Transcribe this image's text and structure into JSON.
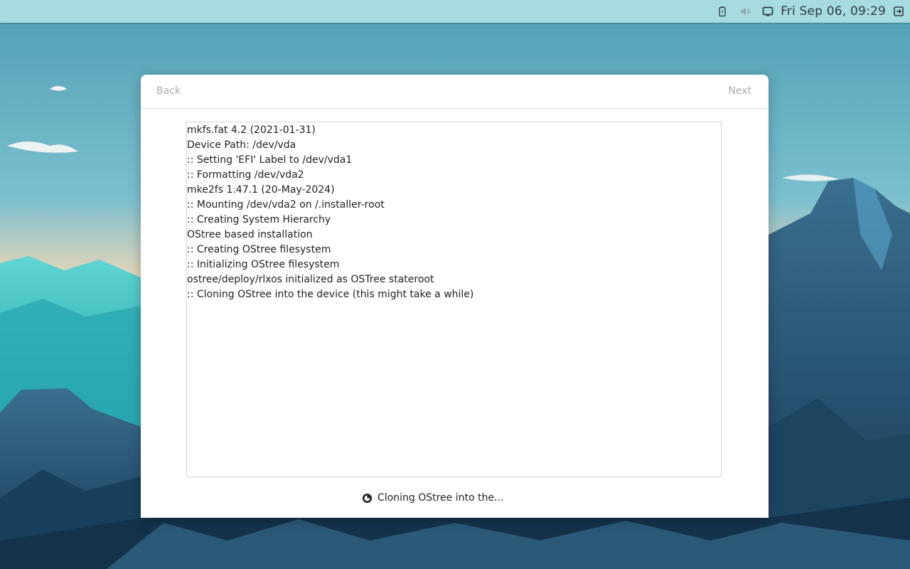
{
  "topbar": {
    "clock": "Fri Sep 06, 09:29",
    "icons": [
      "battery-icon",
      "volume-icon",
      "display-icon",
      "logout-icon"
    ]
  },
  "installer": {
    "back_label": "Back",
    "next_label": "Next",
    "log_lines": [
      "mkfs.fat 4.2 (2021-01-31)",
      "Device Path: /dev/vda",
      ":: Setting 'EFI' Label to /dev/vda1",
      ":: Formatting /dev/vda2",
      "mke2fs 1.47.1 (20-May-2024)",
      ":: Mounting /dev/vda2 on /.installer-root",
      ":: Creating System Hierarchy",
      "OStree based installation",
      ":: Creating OStree filesystem",
      ":: Initializing OStree filesystem",
      "ostree/deploy/rlxos initialized as OSTree stateroot",
      ":: Cloning OStree into the device (this might take a while)"
    ],
    "status_text": "Cloning OStree into the..."
  },
  "colors": {
    "topbar": "#a6dbe0",
    "sky": "#6cb3c5",
    "mountain_dark": "#1f4d6b",
    "mountain_teal": "#2fb3b3"
  }
}
